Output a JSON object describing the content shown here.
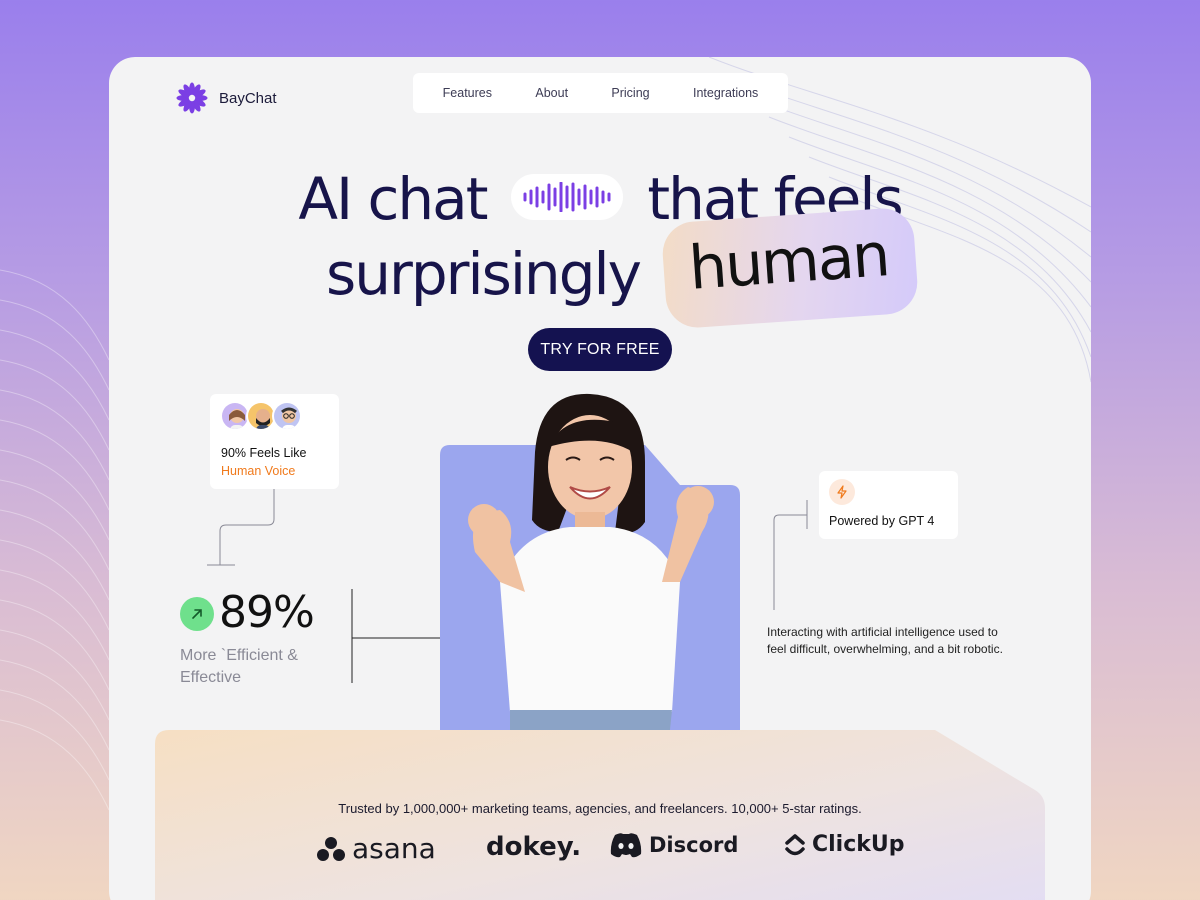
{
  "app": {
    "brand_name": "BayChat",
    "brand_color": "#7b3fe4"
  },
  "nav": {
    "items": [
      "Features",
      "About",
      "Pricing",
      "Integrations"
    ]
  },
  "hero": {
    "line1_part1": "AI chat",
    "line1_part2": "that feels",
    "line2_part1": "surprisingly",
    "highlight": "human",
    "cta_label": "TRY FOR FREE",
    "wave_icon": "audio-wave-icon"
  },
  "social_proof": {
    "line1": "90% Feels Like",
    "line2": "Human Voice",
    "accent_color": "#f07a1c"
  },
  "stat": {
    "value": "89%",
    "caption": "More `Efficient & Effective",
    "icon": "arrow-up-right-icon",
    "icon_color": "#6fe08c"
  },
  "gpt_badge": {
    "label": "Powered by GPT 4",
    "icon": "lightning-icon"
  },
  "description": "Interacting with artificial intelligence used to feel difficult, overwhelming, and a bit robotic.",
  "trust": {
    "text": "Trusted by 1,000,000+ marketing teams, agencies, and freelancers. 10,000+ 5-star ratings.",
    "logos": [
      "asana",
      "dokey.",
      "Discord",
      "ClickUp"
    ]
  }
}
